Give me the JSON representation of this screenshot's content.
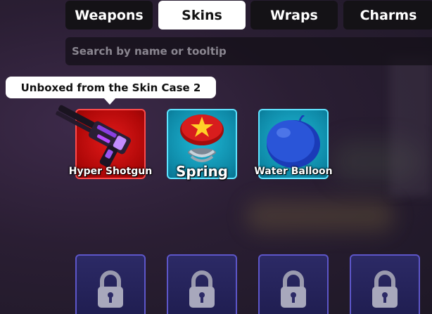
{
  "tabs": [
    {
      "label": "Weapons",
      "active": false
    },
    {
      "label": "Skins",
      "active": true
    },
    {
      "label": "Wraps",
      "active": false
    },
    {
      "label": "Charms",
      "active": false
    }
  ],
  "search": {
    "placeholder": "Search by name or tooltip",
    "value": ""
  },
  "tooltip": {
    "text": "Unboxed from the Skin Case 2"
  },
  "items": [
    {
      "name": "Hyper Shotgun",
      "rarity": "red",
      "icon": "shotgun-icon"
    },
    {
      "name": "Spring",
      "rarity": "cyan",
      "icon": "spring-icon"
    },
    {
      "name": "Water Balloon",
      "rarity": "cyan",
      "icon": "water-balloon-icon"
    }
  ],
  "locked_items": [
    {
      "locked": true,
      "icon": "lock-icon"
    },
    {
      "locked": true,
      "icon": "lock-icon"
    },
    {
      "locked": true,
      "icon": "lock-icon"
    },
    {
      "locked": true,
      "icon": "lock-icon"
    }
  ],
  "colors": {
    "tab_bg": "#141216",
    "tab_active_bg": "#ffffff",
    "rarity_red": "#e21a1a",
    "rarity_cyan": "#1fb8d6",
    "locked_bg": "#2c2a66"
  }
}
